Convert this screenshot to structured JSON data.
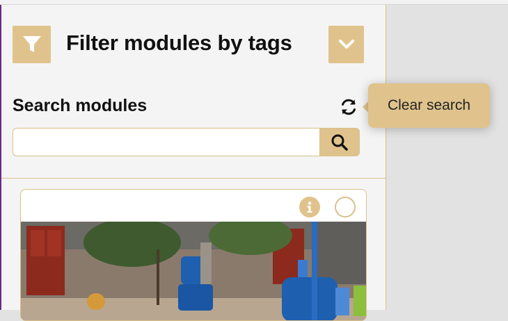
{
  "filter_panel": {
    "title": "Filter modules by tags",
    "filter_icon": "funnel-icon",
    "expand_icon": "chevron-down-icon"
  },
  "search": {
    "label": "Search modules",
    "placeholder": "",
    "value": "",
    "refresh_icon": "refresh-icon",
    "submit_icon": "search-icon"
  },
  "tooltip": {
    "text": "Clear search"
  },
  "module_card": {
    "info_icon": "info-icon",
    "select_icon": "circle-outline-icon",
    "image_alt": "photo of blue water containers outside buildings"
  },
  "colors": {
    "accent": "#e0c38c",
    "border": "#d9c08a",
    "panel_bg": "#f4f4f4",
    "page_bg": "#e2e2e2"
  }
}
